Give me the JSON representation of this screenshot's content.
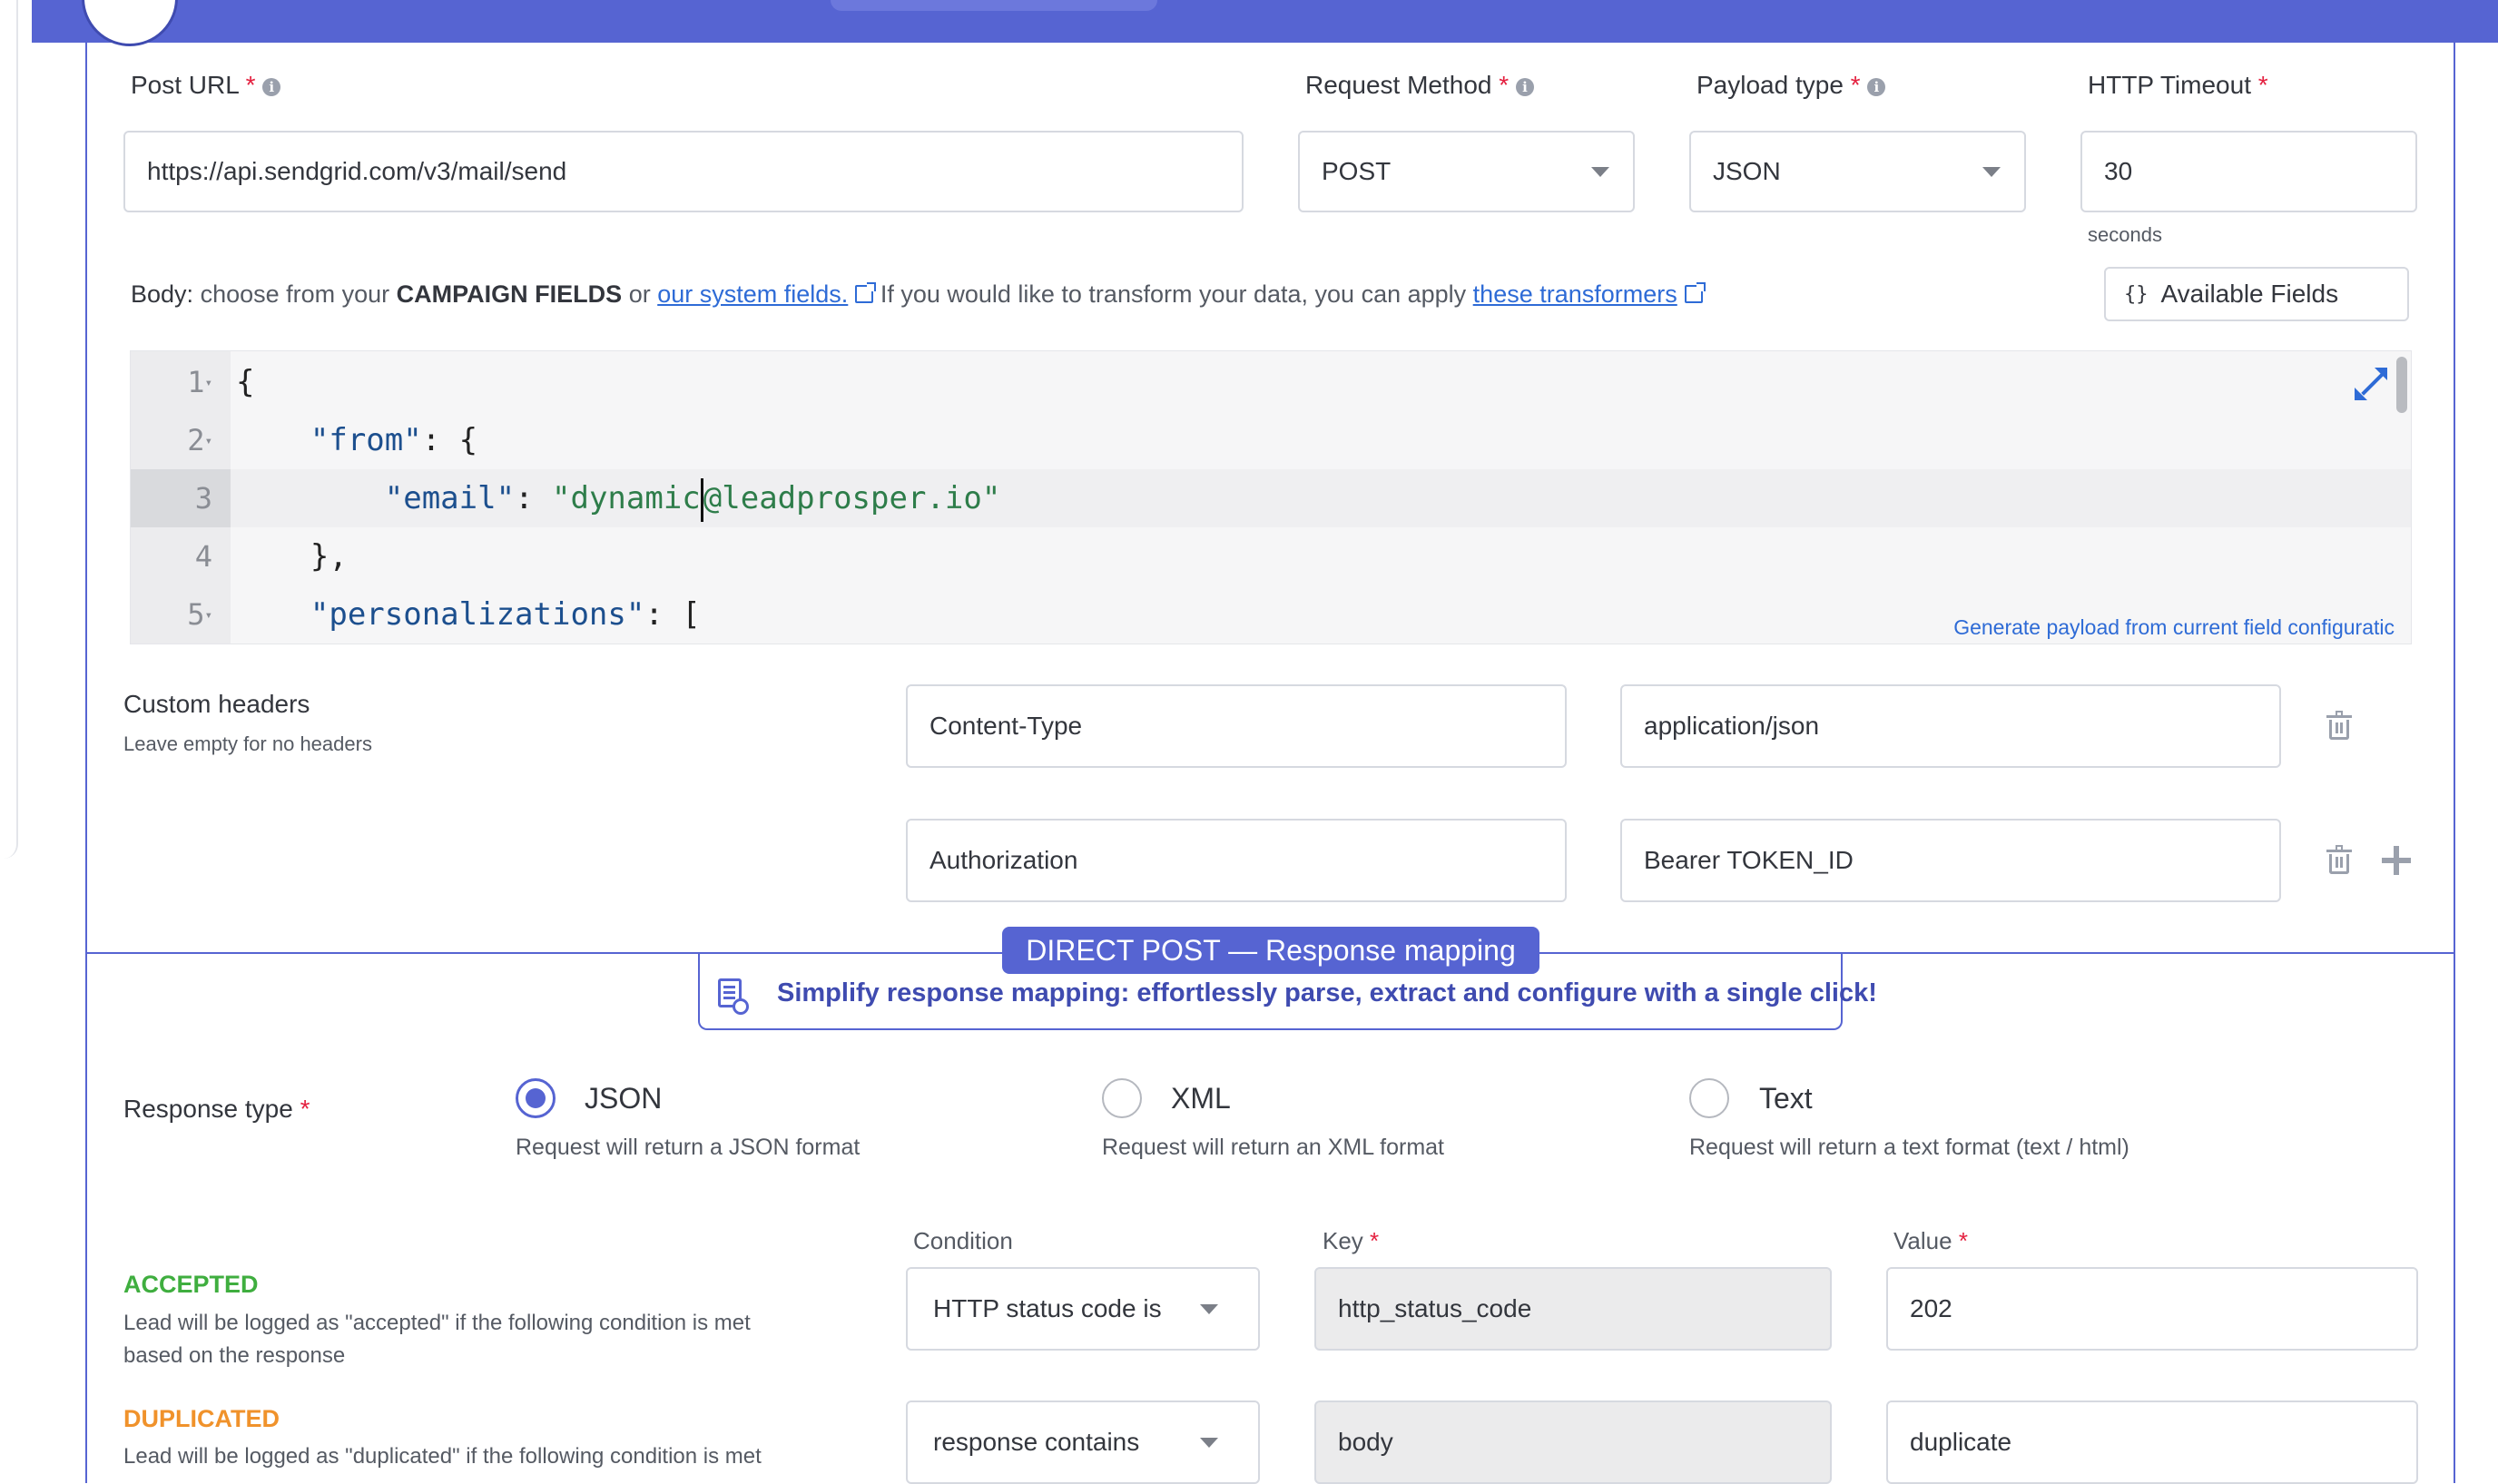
{
  "colors": {
    "accent": "#5664d2",
    "required": "#e4203f",
    "accepted": "#3fae3f",
    "duplicated": "#f0922b",
    "link": "#2e6bd6"
  },
  "post_url": {
    "label": "Post URL",
    "value": "https://api.sendgrid.com/v3/mail/send"
  },
  "request_method": {
    "label": "Request Method",
    "value": "POST"
  },
  "payload_type": {
    "label": "Payload type",
    "value": "JSON"
  },
  "http_timeout": {
    "label": "HTTP Timeout",
    "value": "30",
    "unit": "seconds"
  },
  "body": {
    "label": "Body:",
    "text1": "choose from your",
    "campaign_fields": "CAMPAIGN FIELDS",
    "text2": "or",
    "system_fields_link": "our system fields.",
    "text3": "If you would like to transform your data, you can apply",
    "transformers_link": "these transformers",
    "available_fields_button": "Available Fields",
    "available_fields_icon": "{}",
    "generate_link": "Generate payload from current field configuratic"
  },
  "code_lines": [
    {
      "n": "1",
      "fold": "▾"
    },
    {
      "n": "2",
      "fold": "▾"
    },
    {
      "n": "3",
      "fold": ""
    },
    {
      "n": "4",
      "fold": ""
    },
    {
      "n": "5",
      "fold": "▾"
    }
  ],
  "code": {
    "l1": "{",
    "l2_key": "\"from\"",
    "l2_rest": ": {",
    "l3_key": "\"email\"",
    "l3_colon": ": ",
    "l3_str_a": "\"dynamic",
    "l3_str_b": "@leadprosper.io\"",
    "l4": "},",
    "l5_key": "\"personalizations\"",
    "l5_rest": ": ["
  },
  "custom_headers": {
    "label": "Custom headers",
    "hint": "Leave empty for no headers",
    "rows": [
      {
        "name": "Content-Type",
        "value": "application/json"
      },
      {
        "name": "Authorization",
        "value": "Bearer TOKEN_ID"
      }
    ]
  },
  "response_mapping": {
    "badge": "DIRECT POST — Response mapping",
    "banner": "Simplify response mapping: effortlessly parse, extract and configure with a single click!"
  },
  "response_type": {
    "label": "Response type",
    "options": [
      {
        "label": "JSON",
        "desc": "Request will return a JSON format",
        "selected": true
      },
      {
        "label": "XML",
        "desc": "Request will return an XML format",
        "selected": false
      },
      {
        "label": "Text",
        "desc": "Request will return a text format (text / html)",
        "selected": false
      }
    ]
  },
  "conditions": {
    "col_condition": "Condition",
    "col_key": "Key",
    "col_value": "Value",
    "accepted": {
      "title": "ACCEPTED",
      "desc1": "Lead will be logged as \"accepted\" if the following condition is met",
      "desc2": "based on the response",
      "condition": "HTTP status code is",
      "key": "http_status_code",
      "value": "202"
    },
    "duplicated": {
      "title": "DUPLICATED",
      "desc1": "Lead will be logged as \"duplicated\" if the following condition is met",
      "condition": "response contains",
      "key": "body",
      "value": "duplicate"
    }
  }
}
